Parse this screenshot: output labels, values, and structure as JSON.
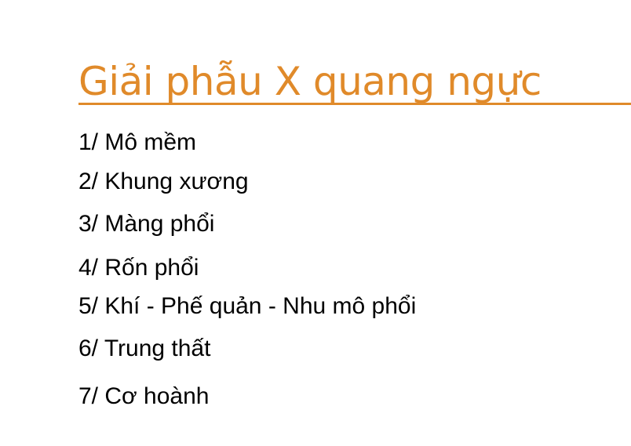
{
  "slide": {
    "title": "Giải phẫu X quang ngực",
    "accent_color": "#E08A2A",
    "items": [
      "1/ Mô mềm",
      "2/ Khung xương",
      "3/ Màng phổi",
      "4/ Rốn phổi",
      "5/ Khí - Phế quản - Nhu mô phổi",
      "6/ Trung thất",
      "7/ Cơ hoành"
    ]
  }
}
